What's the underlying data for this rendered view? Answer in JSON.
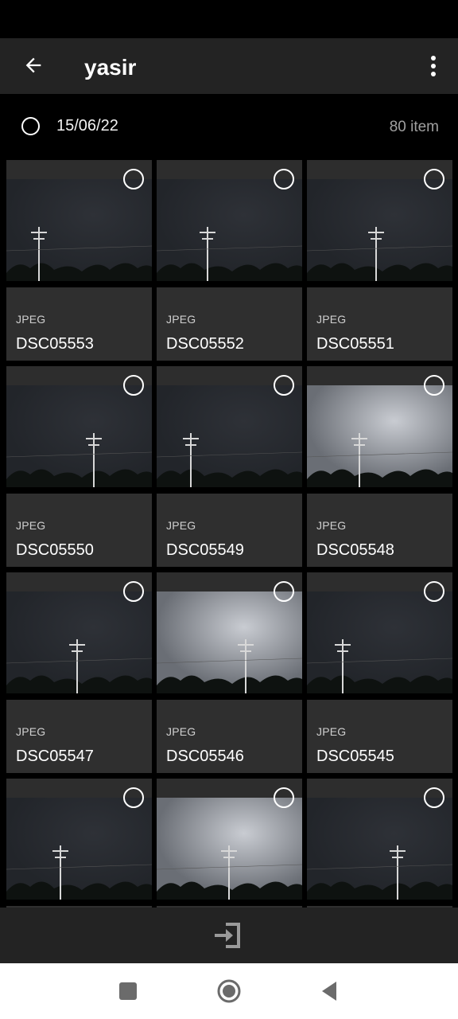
{
  "app_bar": {
    "title": "yasir",
    "back_icon": "arrow-left-icon",
    "menu_icon": "more-vert-icon"
  },
  "date_header": {
    "date": "15/06/22",
    "count": "80 item"
  },
  "items": [
    {
      "format": "JPEG",
      "name": "DSC05553"
    },
    {
      "format": "JPEG",
      "name": "DSC05552"
    },
    {
      "format": "JPEG",
      "name": "DSC05551"
    },
    {
      "format": "JPEG",
      "name": "DSC05550"
    },
    {
      "format": "JPEG",
      "name": "DSC05549"
    },
    {
      "format": "JPEG",
      "name": "DSC05548"
    },
    {
      "format": "JPEG",
      "name": "DSC05547"
    },
    {
      "format": "JPEG",
      "name": "DSC05546"
    },
    {
      "format": "JPEG",
      "name": "DSC05545"
    },
    {
      "format": "",
      "name": ""
    },
    {
      "format": "",
      "name": ""
    },
    {
      "format": "",
      "name": ""
    }
  ],
  "bottom_bar": {
    "icon": "import-icon"
  },
  "nav": {
    "recents_icon": "square-icon",
    "home_icon": "circle-icon",
    "back_icon": "triangle-back-icon"
  },
  "colors": {
    "background": "#000000",
    "bar": "#232323",
    "card": "#2f2f2f",
    "accent": "#ffffff"
  }
}
